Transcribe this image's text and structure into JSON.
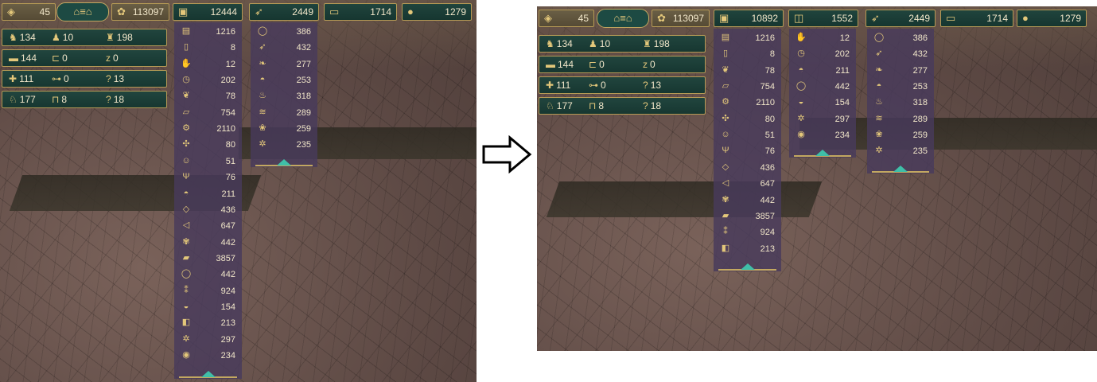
{
  "arrow_icon": "right-arrow-icon",
  "left": {
    "top": {
      "happiness": {
        "icon": "diamond-icon",
        "value": "45"
      },
      "dwellers": {
        "icon": "dwellers-icon"
      },
      "prestige": {
        "icon": "flower-icon",
        "value": "113097"
      },
      "crates": {
        "icon": "crate-icon",
        "value": "12444"
      },
      "food": {
        "icon": "carrot-icon",
        "value": "2449"
      },
      "wood": {
        "icon": "log-icon",
        "value": "1714"
      },
      "water": {
        "icon": "water-drop-icon",
        "value": "1279"
      }
    },
    "population": [
      [
        {
          "icon": "worker-icon",
          "value": "134"
        },
        {
          "icon": "walker-icon",
          "value": "10"
        },
        {
          "icon": "elder-icon",
          "value": "198"
        }
      ],
      [
        {
          "icon": "bed-icon",
          "value": "144"
        },
        {
          "icon": "empty-bed-icon",
          "value": "0"
        },
        {
          "icon": "sleep-icon",
          "value": "0"
        }
      ],
      [
        {
          "icon": "kit-icon",
          "value": "111"
        },
        {
          "icon": "stretcher-icon",
          "value": "0"
        },
        {
          "icon": "question-icon",
          "value": "13"
        }
      ],
      [
        {
          "icon": "beaver-icon",
          "value": "177"
        },
        {
          "icon": "cot-icon",
          "value": "8"
        },
        {
          "icon": "question-icon",
          "value": "18"
        }
      ]
    ],
    "goods": [
      {
        "icon": "punch-card-icon",
        "value": "1216"
      },
      {
        "icon": "book-icon",
        "value": "8"
      },
      {
        "icon": "gear-hand-icon",
        "value": "12"
      },
      {
        "icon": "clock-icon",
        "value": "202"
      },
      {
        "icon": "brain-icon",
        "value": "78"
      },
      {
        "icon": "plank-icon",
        "value": "754"
      },
      {
        "icon": "gear-icon",
        "value": "2110"
      },
      {
        "icon": "network-icon",
        "value": "80"
      },
      {
        "icon": "head-icon",
        "value": "51"
      },
      {
        "icon": "antler-icon",
        "value": "76"
      },
      {
        "icon": "bread-icon",
        "value": "211"
      },
      {
        "icon": "board-icon",
        "value": "436"
      },
      {
        "icon": "fish-icon",
        "value": "647"
      },
      {
        "icon": "herb-icon",
        "value": "442"
      },
      {
        "icon": "lumber-icon",
        "value": "3857"
      },
      {
        "icon": "potato-icon",
        "value": "442"
      },
      {
        "icon": "grain-icon",
        "value": "924"
      },
      {
        "icon": "pie-icon",
        "value": "154"
      },
      {
        "icon": "treated-plank-icon",
        "value": "213"
      },
      {
        "icon": "wheat-icon",
        "value": "297"
      },
      {
        "icon": "canned-icon",
        "value": "234"
      }
    ],
    "food": [
      {
        "icon": "potato-icon",
        "value": "386"
      },
      {
        "icon": "carrot-icon",
        "value": "432"
      },
      {
        "icon": "cattail-icon",
        "value": "277"
      },
      {
        "icon": "bread-icon",
        "value": "253"
      },
      {
        "icon": "soup-icon",
        "value": "318"
      },
      {
        "icon": "grilled-icon",
        "value": "289"
      },
      {
        "icon": "berry-icon",
        "value": "259"
      },
      {
        "icon": "wheat-icon",
        "value": "235"
      }
    ]
  },
  "right": {
    "top": {
      "happiness": {
        "icon": "diamond-icon",
        "value": "45"
      },
      "dwellers": {
        "icon": "dwellers-icon"
      },
      "prestige": {
        "icon": "flower-icon",
        "value": "113097"
      },
      "crates": {
        "icon": "crate-icon",
        "value": "10892"
      },
      "processed": {
        "icon": "box-icon",
        "value": "1552"
      },
      "food": {
        "icon": "carrot-icon",
        "value": "2449"
      },
      "wood": {
        "icon": "log-icon",
        "value": "1714"
      },
      "water": {
        "icon": "water-drop-icon",
        "value": "1279"
      }
    },
    "population": [
      [
        {
          "icon": "worker-icon",
          "value": "134"
        },
        {
          "icon": "walker-icon",
          "value": "10"
        },
        {
          "icon": "elder-icon",
          "value": "198"
        }
      ],
      [
        {
          "icon": "bed-icon",
          "value": "144"
        },
        {
          "icon": "empty-bed-icon",
          "value": "0"
        },
        {
          "icon": "sleep-icon",
          "value": "0"
        }
      ],
      [
        {
          "icon": "kit-icon",
          "value": "111"
        },
        {
          "icon": "stretcher-icon",
          "value": "0"
        },
        {
          "icon": "question-icon",
          "value": "13"
        }
      ],
      [
        {
          "icon": "beaver-icon",
          "value": "177"
        },
        {
          "icon": "cot-icon",
          "value": "8"
        },
        {
          "icon": "question-icon",
          "value": "18"
        }
      ]
    ],
    "goods": [
      {
        "icon": "punch-card-icon",
        "value": "1216"
      },
      {
        "icon": "book-icon",
        "value": "8"
      },
      {
        "icon": "brain-icon",
        "value": "78"
      },
      {
        "icon": "plank-icon",
        "value": "754"
      },
      {
        "icon": "gear-icon",
        "value": "2110"
      },
      {
        "icon": "network-icon",
        "value": "80"
      },
      {
        "icon": "head-icon",
        "value": "51"
      },
      {
        "icon": "antler-icon",
        "value": "76"
      },
      {
        "icon": "board-icon",
        "value": "436"
      },
      {
        "icon": "fish-icon",
        "value": "647"
      },
      {
        "icon": "herb-icon",
        "value": "442"
      },
      {
        "icon": "lumber-icon",
        "value": "3857"
      },
      {
        "icon": "grain-icon",
        "value": "924"
      },
      {
        "icon": "treated-plank-icon",
        "value": "213"
      }
    ],
    "processed": [
      {
        "icon": "gear-hand-icon",
        "value": "12"
      },
      {
        "icon": "clock-icon",
        "value": "202"
      },
      {
        "icon": "bread-icon",
        "value": "211"
      },
      {
        "icon": "potato-icon",
        "value": "442"
      },
      {
        "icon": "pie-icon",
        "value": "154"
      },
      {
        "icon": "wheat-icon",
        "value": "297"
      },
      {
        "icon": "canned-icon",
        "value": "234"
      }
    ],
    "food": [
      {
        "icon": "potato-icon",
        "value": "386"
      },
      {
        "icon": "carrot-icon",
        "value": "432"
      },
      {
        "icon": "cattail-icon",
        "value": "277"
      },
      {
        "icon": "bread-icon",
        "value": "253"
      },
      {
        "icon": "soup-icon",
        "value": "318"
      },
      {
        "icon": "grilled-icon",
        "value": "289"
      },
      {
        "icon": "berry-icon",
        "value": "259"
      },
      {
        "icon": "wheat-icon",
        "value": "235"
      }
    ]
  }
}
